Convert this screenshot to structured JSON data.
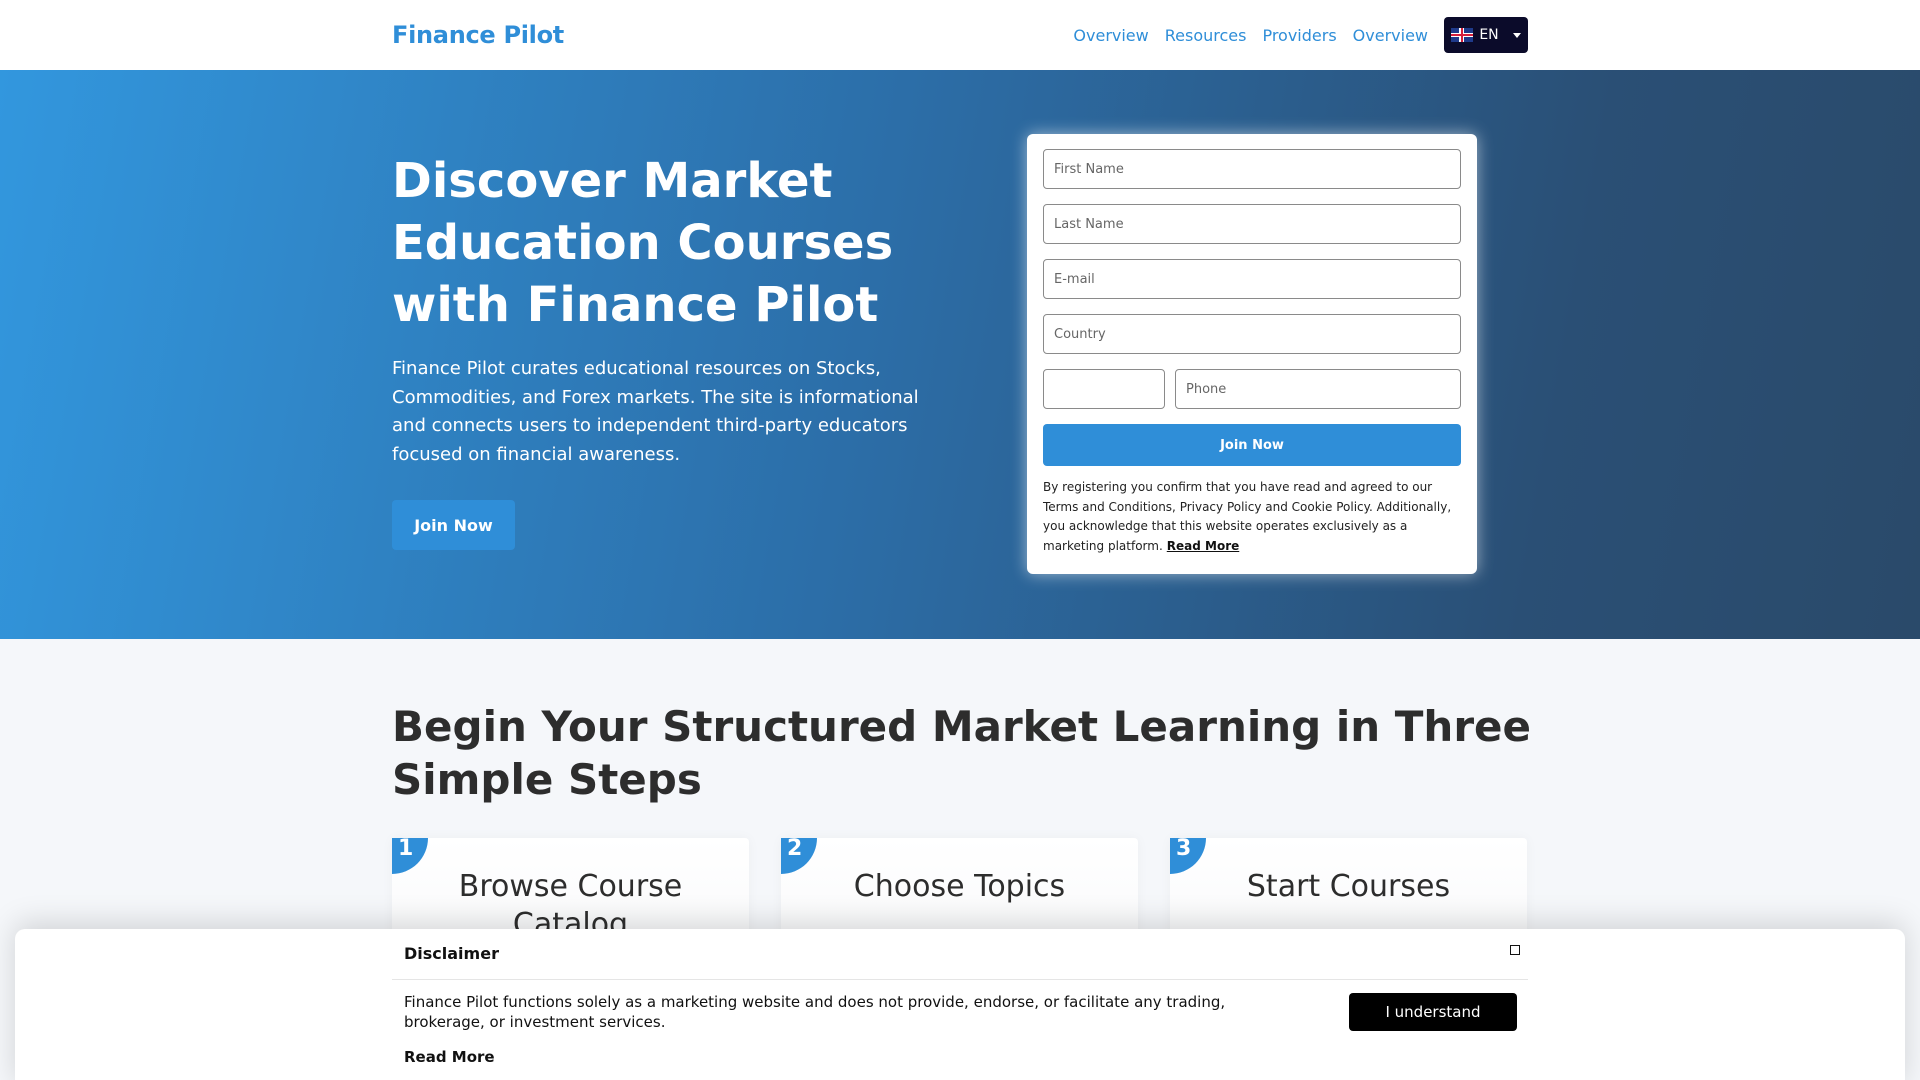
{
  "header": {
    "logo": "Finance Pilot",
    "nav": [
      "Overview",
      "Resources",
      "Providers",
      "Overview"
    ],
    "language": "EN"
  },
  "hero": {
    "title": "Discover Market Education Courses with Finance Pilot",
    "description": "Finance Pilot curates educational resources on Stocks, Commodities, and Forex markets. The site is informational and connects users to independent third-party educators focused on financial awareness.",
    "cta": "Join Now"
  },
  "form": {
    "first_name_placeholder": "First Name",
    "last_name_placeholder": "Last Name",
    "email_placeholder": "E-mail",
    "country_placeholder": "Country",
    "phone_code_value": "",
    "phone_placeholder": "Phone",
    "submit": "Join Now",
    "legal_text": "By registering you confirm that you have read and agreed to our Terms and Conditions, Privacy Policy and Cookie Policy. Additionally, you acknowledge that this website operates exclusively as a marketing platform.",
    "read_more": "Read More"
  },
  "steps": {
    "title": "Begin Your Structured Market Learning in Three Simple Steps",
    "cards": [
      {
        "number": "1",
        "title": "Browse Course Catalog"
      },
      {
        "number": "2",
        "title": "Choose Topics"
      },
      {
        "number": "3",
        "title": "Start Courses"
      }
    ]
  },
  "disclaimer": {
    "title": "Disclaimer",
    "close_icon": "close-icon",
    "text": "Finance Pilot functions solely as a marketing website and does not provide, endorse, or facilitate any trading, brokerage, or investment services.",
    "read_more": "Read More",
    "button": "I understand"
  },
  "colors": {
    "accent": "#2f8ed8",
    "hero_start": "#3297de",
    "hero_end": "#2a4a6a",
    "dark_button": "#000000"
  }
}
